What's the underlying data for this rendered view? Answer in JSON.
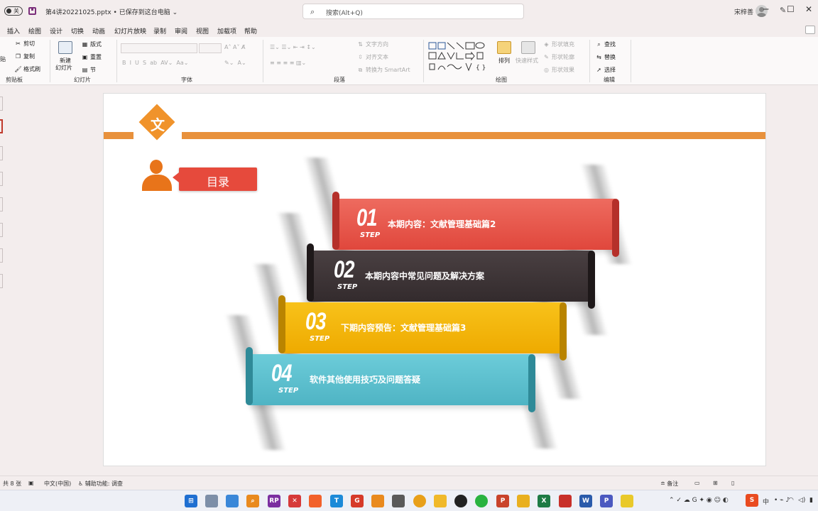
{
  "titlebar": {
    "toggle_label": "关",
    "doc_title": "第4讲20221025.pptx • 已保存到这台电脑 ⌄",
    "search_placeholder": "搜索(Alt+Q)",
    "user_name": "宋梓善",
    "min_glyph": "─",
    "max_glyph": "☐",
    "close_glyph": "✕"
  },
  "menu": [
    "插入",
    "绘图",
    "设计",
    "切换",
    "动画",
    "幻灯片放映",
    "录制",
    "审阅",
    "视图",
    "加载项",
    "帮助"
  ],
  "ribbon": {
    "clipboard": {
      "label": "剪贴板",
      "paste": "贴",
      "cut": "剪切",
      "copy": "复制",
      "format_painter": "格式刷"
    },
    "slides": {
      "label": "幻灯片",
      "new_slide": "新建",
      "new_slide2": "幻灯片",
      "layout": "版式",
      "reset": "重置",
      "section": "节"
    },
    "font": {
      "label": "字体"
    },
    "paragraph": {
      "label": "段落",
      "text_direction": "文字方向",
      "align_text": "对齐文本",
      "smartart": "转换为 SmartArt"
    },
    "drawing": {
      "label": "绘图",
      "arrange": "排列",
      "quick_styles": "快速样式",
      "shape_fill": "形状填充",
      "shape_outline": "形状轮廓",
      "shape_effects": "形状效果"
    },
    "editing": {
      "label": "编辑",
      "find": "查找",
      "replace": "替换",
      "select": "选择"
    }
  },
  "slide": {
    "badge_char": "文",
    "toc_label": "目录",
    "steps": [
      {
        "num": "01",
        "step": "STEP",
        "text": "本期内容：文献管理基础篇2",
        "color": "#e8534a"
      },
      {
        "num": "02",
        "step": "STEP",
        "text": "本期内容中常见问题及解决方案",
        "color": "#3d3436"
      },
      {
        "num": "03",
        "step": "STEP",
        "text": "下期内容预告：文献管理基础篇3",
        "color": "#f4b400"
      },
      {
        "num": "04",
        "step": "STEP",
        "text": "软件其他使用技巧及问题答疑",
        "color": "#5bbfcf"
      }
    ]
  },
  "status": {
    "slide_count": "共 8 张",
    "language": "中文(中国)",
    "accessibility": "辅助功能: 调查",
    "notes": "备注"
  },
  "tray": {
    "ime": "中"
  }
}
